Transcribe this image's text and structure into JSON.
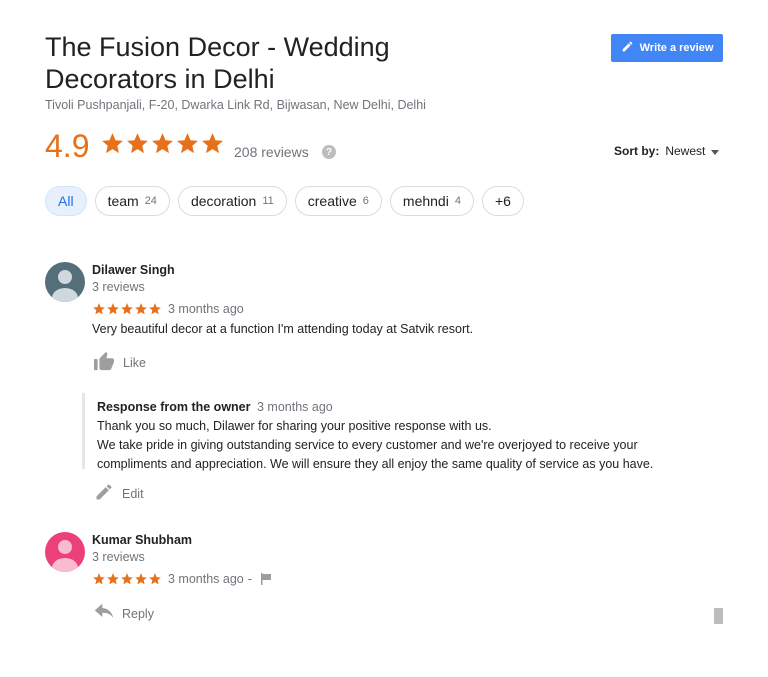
{
  "header": {
    "title": "The Fusion Decor - Wedding Decorators in Delhi",
    "address": "Tivoli Pushpanjali, F-20, Dwarka Link Rd, Bijwasan, New Delhi, Delhi",
    "write_review_label": "Write a review"
  },
  "summary": {
    "rating": "4.9",
    "stars": 5,
    "review_count": "208 reviews",
    "help_icon": "?"
  },
  "sort": {
    "label": "Sort by:",
    "value": "Newest"
  },
  "chips": [
    {
      "label": "All",
      "count": "",
      "active": true
    },
    {
      "label": "team",
      "count": "24"
    },
    {
      "label": "decoration",
      "count": "11"
    },
    {
      "label": "creative",
      "count": "6"
    },
    {
      "label": "mehndi",
      "count": "4"
    },
    {
      "label": "+6",
      "count": ""
    }
  ],
  "reviews": [
    {
      "name": "Dilawer Singh",
      "reviews": "3 reviews",
      "stars": 5,
      "time": "3 months ago",
      "text": "Very beautiful decor at a function  I'm  attending today at Satvik resort.",
      "action": "Like",
      "avatar_color": "#546e7a",
      "owner_response": {
        "label": "Response from the owner",
        "time": "3 months ago",
        "lines": [
          "Thank you so much, Dilawer for sharing your positive response with us.",
          "We take pride in giving outstanding service to every customer and we're overjoyed to receive your",
          "compliments and appreciation. We will ensure they all enjoy the same quality of service as you have."
        ],
        "action": "Edit"
      }
    },
    {
      "name": "Kumar Shubham",
      "reviews": "3 reviews",
      "stars": 5,
      "time": "3 months ago",
      "separator": "-",
      "action": "Reply",
      "avatar_color": "#ec407a"
    }
  ],
  "colors": {
    "star": "#e7711b",
    "primary": "#4285f4",
    "muted": "#70757a"
  }
}
